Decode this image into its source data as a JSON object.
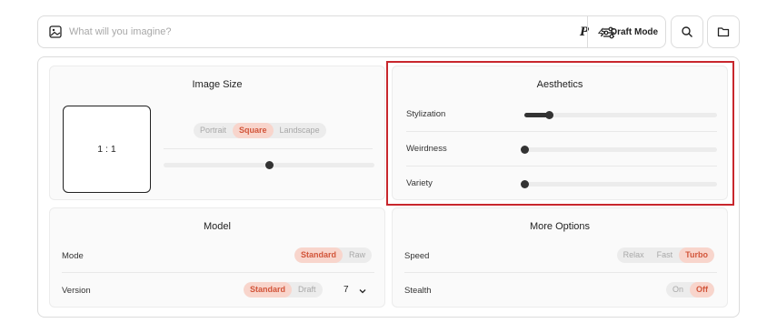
{
  "prompt": {
    "placeholder": "What will you imagine?",
    "value": "",
    "p_label": "P",
    "draft_label": "Draft Mode"
  },
  "image_size": {
    "title": "Image Size",
    "aspect_ratio": "1 : 1",
    "options": [
      "Portrait",
      "Square",
      "Landscape"
    ],
    "selected": "Square",
    "slider_fraction": 0.5
  },
  "aesthetics": {
    "title": "Aesthetics",
    "rows": [
      {
        "label": "Stylization",
        "fraction": 0.13
      },
      {
        "label": "Weirdness",
        "fraction": 0.0
      },
      {
        "label": "Variety",
        "fraction": 0.0
      }
    ]
  },
  "model": {
    "title": "Model",
    "mode_label": "Mode",
    "mode_options": [
      "Standard",
      "Raw"
    ],
    "mode_selected": "Standard",
    "version_label": "Version",
    "version_options": [
      "Standard",
      "Draft"
    ],
    "version_selected": "Standard",
    "version_number": "7"
  },
  "more_options": {
    "title": "More Options",
    "speed_label": "Speed",
    "speed_options": [
      "Relax",
      "Fast",
      "Turbo"
    ],
    "speed_selected": "Turbo",
    "stealth_label": "Stealth",
    "stealth_options": [
      "On",
      "Off"
    ],
    "stealth_selected": "Off"
  },
  "colors": {
    "accent": "#d2553a",
    "accent_bg": "#f8d5cc",
    "highlight_border": "#c8272d"
  }
}
